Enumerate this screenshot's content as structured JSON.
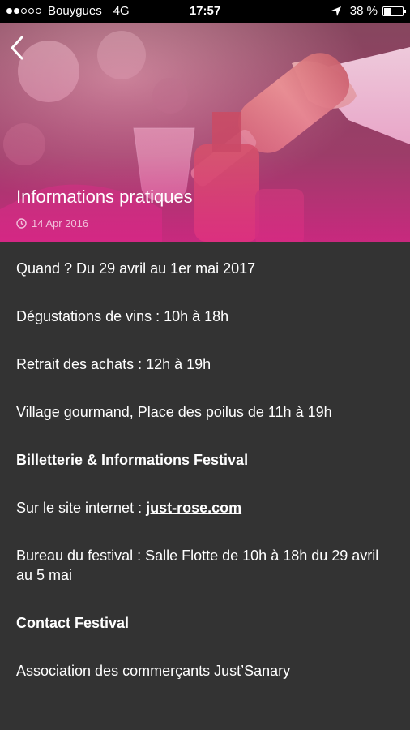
{
  "status_bar": {
    "signal_full": 2,
    "signal_total": 5,
    "carrier": "Bouygues",
    "network": "4G",
    "time": "17:57",
    "battery": "38 %",
    "battery_level": 0.38
  },
  "header": {
    "back_icon": "chevron-left-icon",
    "title": "Informations pratiques",
    "date_icon": "clock-icon",
    "date": "14 Apr 2016"
  },
  "content": {
    "when": "Quand ? Du 29 avril au 1er mai 2017",
    "tastings": "Dégustations de vins : 10h à 18h",
    "pickup": "Retrait des achats : 12h à 19h",
    "village": "Village gourmand, Place des poilus de 11h à 19h",
    "ticketing_heading": "Billetterie & Informations Festival",
    "website_prefix": "Sur le site internet : ",
    "website_link": "just-rose.com",
    "office": "Bureau du festival : Salle Flotte de 10h à 18h du 29 avril au 5 mai",
    "contact_heading": "Contact Festival",
    "association": "Association des commerçants Just’Sanary"
  },
  "colors": {
    "accent": "#e2378f",
    "background": "#333333",
    "text": "#ffffff"
  }
}
